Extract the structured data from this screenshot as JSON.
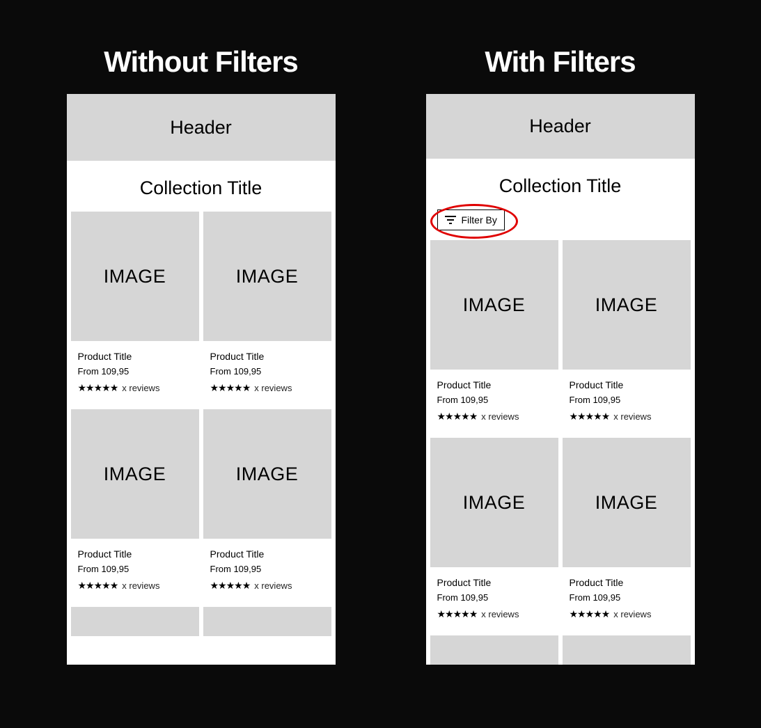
{
  "panels": [
    {
      "title": "Without Filters",
      "hasFilter": false
    },
    {
      "title": "With Filters",
      "hasFilter": true
    }
  ],
  "header": "Header",
  "collectionTitle": "Collection Title",
  "filterLabel": "Filter By",
  "imagePlaceholder": "IMAGE",
  "product": {
    "title": "Product Title",
    "price": "From 109,95",
    "stars": "★★★★★",
    "reviews": "x reviews"
  }
}
